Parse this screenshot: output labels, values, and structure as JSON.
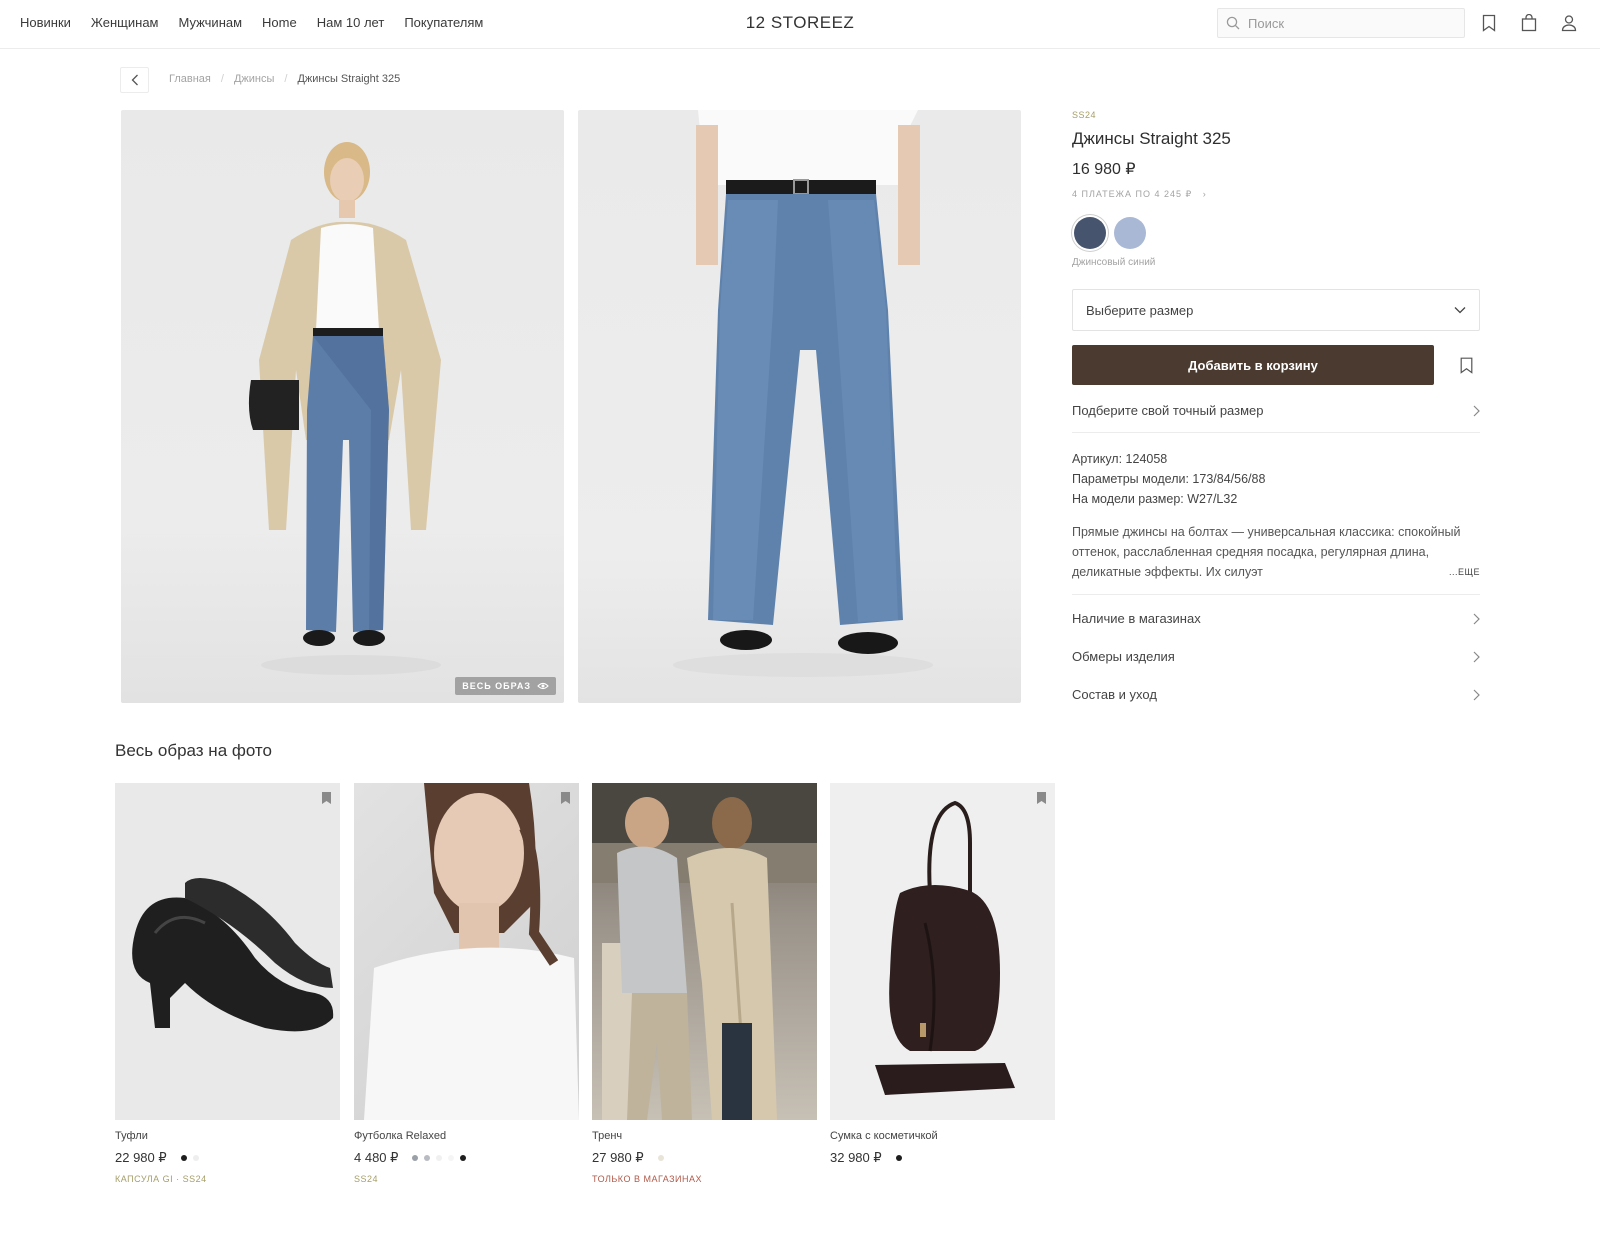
{
  "nav": [
    "Новинки",
    "Женщинам",
    "Мужчинам",
    "Home",
    "Нам 10 лет",
    "Покупателям"
  ],
  "logo": "12 STOREEZ",
  "search": {
    "placeholder": "Поиск"
  },
  "breadcrumb": {
    "home": "Главная",
    "category": "Джинсы",
    "current": "Джинсы Straight 325"
  },
  "gallery": {
    "look_badge": "ВЕСЬ ОБРАЗ"
  },
  "product": {
    "season": "SS24",
    "title": "Джинсы Straight 325",
    "price": "16 980 ₽",
    "installment": "4 ПЛАТЕЖА ПО 4 245 ₽",
    "colors": [
      {
        "name": "Джинсовый синий",
        "hex": "#46546e"
      },
      {
        "name": "Светло-голубой",
        "hex": "#a9b8d4"
      }
    ],
    "color_name": "Джинсовый синий",
    "size_placeholder": "Выберите размер",
    "add_to_cart": "Добавить в корзину",
    "fit_link": "Подберите свой точный размер",
    "article": "Артикул: 124058",
    "model_params": "Параметры модели: 173/84/56/88",
    "model_size": "На модели размер: W27/L32",
    "description": "Прямые джинсы на болтах — универсальная классика: спокойный оттенок, расслабленная средняя посадка, регулярная длина, деликатные эффекты. Их силуэт",
    "more": "...ЕЩЕ",
    "accordion": [
      "Наличие в магазинах",
      "Обмеры изделия",
      "Состав и уход"
    ]
  },
  "look": {
    "title": "Весь образ на фото",
    "items": [
      {
        "name": "Туфли",
        "price": "22 980 ₽",
        "tag": "КАПСУЛА GI · SS24",
        "tag_color": "#a59e6a",
        "dots": [
          "#1e1e1e",
          "#eeeeee"
        ]
      },
      {
        "name": "Футболка Relaxed",
        "price": "4 480 ₽",
        "tag": "SS24",
        "tag_color": "#a59e6a",
        "dots": [
          "#9aa0a8",
          "#b8bcc2",
          "#f0f0f0",
          "#f5f5f5",
          "#1e1e1e"
        ]
      },
      {
        "name": "Тренч",
        "price": "27 980 ₽",
        "tag": "ТОЛЬКО В МАГАЗИНАХ",
        "tag_color": "#b05a4a",
        "dots": [
          "#e9e4d8"
        ]
      },
      {
        "name": "Сумка с косметичкой",
        "price": "32 980 ₽",
        "tag": "",
        "tag_color": "#a59e6a",
        "dots": [
          "#1e1e1e"
        ]
      }
    ]
  }
}
